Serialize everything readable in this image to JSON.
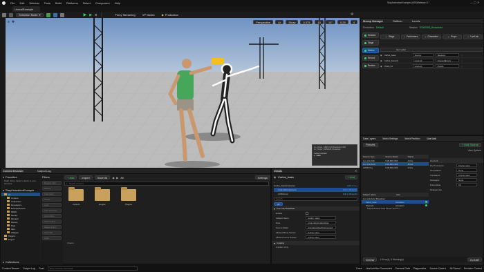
{
  "window": {
    "project": "UnrealExample",
    "title": "StayAnimationExample (UE5)Release-5.7"
  },
  "menu": [
    "File",
    "Edit",
    "Window",
    "Tools",
    "Build",
    "Platforms",
    "Select",
    "Component",
    "Help"
  ],
  "toolbar": {
    "selection_mode": "Selection Mode",
    "proxy_streaming": "Proxy Streaming",
    "vp_nodes": "VP Nodes",
    "production": "Production"
  },
  "viewport": {
    "view": "Perspective",
    "lit": "Lit",
    "show": "Show",
    "speed": "0.375",
    "grid": "10",
    "angle": "10°",
    "scale": "0.25",
    "cam": "4",
    "popup": {
      "line1": "Inc_Finger_GBS0 0.00 Broadcast 0.000",
      "line2": "Inc_Finger_20250325_Broadcast",
      "label": "Current Context:",
      "value": "Label"
    }
  },
  "mocap": {
    "tab_title": "Mocap Manager",
    "outliner": "Outliner",
    "levels": "Levels",
    "production_label": "Production",
    "production_value": "Default",
    "session_label": "Session",
    "session_value": "20260305_Broadcast",
    "left_nav": [
      "Session",
      "Stage",
      "Motion",
      "Record",
      "Review"
    ],
    "stage_tabs": [
      "Stage",
      "Performers",
      "Characters",
      "Props",
      "LiveLink"
    ],
    "item_label": "Item Label",
    "rows": [
      {
        "name": "Carlos_base",
        "source": "Source",
        "node": "Skeleton"
      },
      {
        "name": "Carlos_base(1)",
        "source": "LiveLink",
        "node": "Unused/Empty"
      },
      {
        "name": "Pistol_01",
        "source": "LiveLink",
        "node": "Pistol1"
      }
    ]
  },
  "data_layers": {
    "tabs": [
      "Data Layers",
      "World Settings",
      "World Partition",
      "Live Link"
    ],
    "presets": "Presets",
    "add_source": "+ Add Source",
    "view_options": "View Options",
    "cols": [
      "Source Type",
      "Source Machi",
      "Status"
    ],
    "sources": [
      {
        "type": "Live Link Hub",
        "machine": "LNR-MD-2266",
        "status": "Active"
      },
      {
        "type": "Live Link Actor",
        "machine": "LNR-MD-2266",
        "status": "Active"
      },
      {
        "type": "cMKS Pres",
        "machine": "LNR-MD-2266",
        "status": "Active"
      }
    ],
    "subject_cols": [
      "Subject Name",
      "Role"
    ],
    "subjects": [
      {
        "name": "Live Link Actor Broadcast",
        "role": ""
      },
      {
        "name": "Carlos_base",
        "role": "Animation"
      },
      {
        "name": "Pistol_01",
        "role": "Animation"
      }
    ],
    "playback": "Playback Music Data Stream Source 1",
    "props": [
      {
        "label": "Live Link",
        "value": ""
      },
      {
        "label": "Pre Processors",
        "value": "0 Array elem"
      },
      {
        "label": "Interpolation",
        "value": "None"
      },
      {
        "label": "Translators",
        "value": "0 Array elem"
      },
      {
        "label": "Remapper",
        "value": "None"
      },
      {
        "label": "Frame Rate",
        "value": "0.0"
      },
      {
        "label": "Retarget Use",
        "value": ""
      }
    ],
    "show": "SHOW",
    "messages": "4 Error(s), 5 Warning(s)",
    "clear": "CLEAR"
  },
  "content_browser": {
    "tab": "Content Browser",
    "output_log": "Output Log",
    "add": "+ Add",
    "import": "Import",
    "save_all": "Save All",
    "settings": "Settings",
    "path": "All",
    "search": "Search Content",
    "favorites": "Favorites",
    "favorites_hint": "Right click a folder to add it to your favorites",
    "root": "StayAnimationExample",
    "tree": [
      "All",
      "Content",
      "Collections",
      "Developers",
      "ExampleAssets",
      "FBHS",
      "Mocap",
      "Mocap2",
      "Movies",
      "Rigs",
      "Skin",
      "Widgets",
      "Plugins",
      "Engine"
    ],
    "filters_title": "Filters",
    "filters": [
      "Blueprint Class",
      "Material",
      "Static Mesh",
      "Texture",
      "Level",
      "Anim Sequence",
      "Sound Wave",
      "Skeletal Mesh",
      "Niagara System",
      "Data Table",
      "Audio"
    ],
    "folders": [
      "Content",
      "Engine",
      "Plugins"
    ],
    "items_count": "3 items",
    "collections": "Collections"
  },
  "details": {
    "tab": "Details",
    "actor": "Carlos_basic",
    "add": "+ Add",
    "components": [
      {
        "name": "Carlos_basic(Instance)",
        "action": "Edit in C++"
      },
      {
        "name": "LiveLinkComponent",
        "action": "Edit in Blueprint"
      },
      {
        "name": "LODGroup",
        "action": "Edit in Blueprint"
      }
    ],
    "search": "Search",
    "tab_all": "All",
    "section_livelink": "Live Link Broadcast",
    "fields": [
      {
        "label": "Enable",
        "value": ""
      },
      {
        "label": "Subject Name",
        "value": "Carlos_basic"
      },
      {
        "label": "Role",
        "value": "LiveLinkAnimationRole"
      },
      {
        "label": "Source Mode",
        "value": "AnimationMeshComponent"
      },
      {
        "label": "Allowed Bone Names",
        "value": "0 Array elem"
      },
      {
        "label": "Allowed Curve Names",
        "value": "0 Array elem"
      }
    ],
    "section_cooking": "Cooking",
    "cook_label": "Is Editor Only"
  },
  "statusbar": {
    "content_drawer": "Content Drawer",
    "output_log": "Output Log",
    "cmd": "Cmd",
    "console_placeholder": "Enter Console Command",
    "trace": "Trace",
    "livelink": "LiveLinkHub Connected",
    "derived": "Derived Data",
    "diagnostics": "Diagnostics",
    "source_control": "Source Control",
    "all_saved": "All Saved",
    "revision": "Revision Control"
  },
  "colors": {
    "accent": "#3cd36a",
    "selection": "#1e4e8c",
    "bg": "#1f1f1f"
  }
}
